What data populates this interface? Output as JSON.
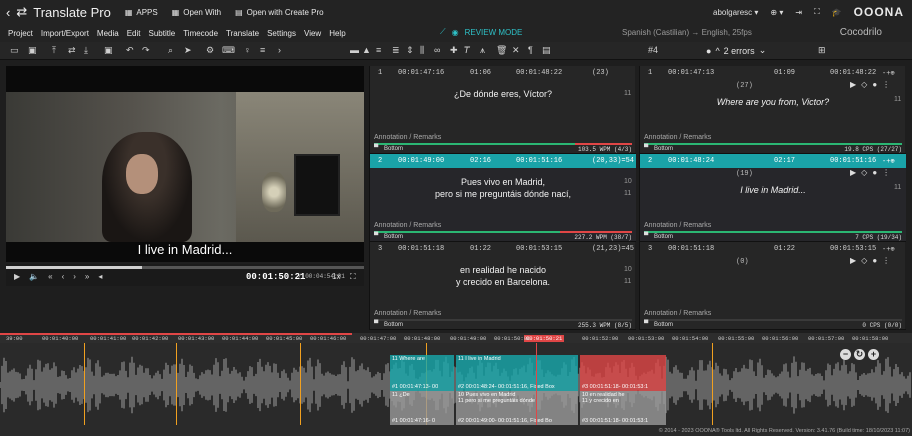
{
  "app": {
    "title": "Translate Pro",
    "apps_label": "APPS",
    "open_with_label": "Open With",
    "open_create_label": "Open with Create Pro",
    "user": "abolgaresc",
    "logo_text": "OOONA"
  },
  "menu": {
    "items": [
      "Project",
      "Import/Export",
      "Media",
      "Edit",
      "Subtitle",
      "Timecode",
      "Translate",
      "Settings",
      "View",
      "Help"
    ],
    "review_mode": "REVIEW MODE",
    "language_pair": "Spanish (Castilian) → English, 25fps",
    "project_name": "Cocodrilo"
  },
  "toolbar": {
    "current_number": "#4",
    "errors_label": "2 errors"
  },
  "video": {
    "subtitle": "I live in Madrid...",
    "current_time": "00:01:50:21",
    "duration": "/ 00:04:54:01",
    "speed": "1x"
  },
  "source": {
    "rows": [
      {
        "num": "1",
        "in": "00:01:47:16",
        "dur": "01:06",
        "out": "00:01:48:22",
        "chars": "(23)",
        "text1": "¿De dónde eres, Víctor?",
        "text2": "",
        "cc1": "11",
        "cc2": "",
        "annotation": "Annotation / Remarks",
        "position": "Bottom",
        "wpm": "103.5 WPM (4/3)",
        "bar": 0.78,
        "active": false
      },
      {
        "num": "2",
        "in": "00:01:49:00",
        "dur": "02:16",
        "out": "00:01:51:16",
        "chars": "(20,33)=54",
        "text1": "Pues vivo en Madrid,",
        "text2": "pero si me preguntáis dónde nací,",
        "cc1": "10",
        "cc2": "11",
        "annotation": "Annotation / Remarks",
        "position": "Bottom",
        "wpm": "227.2 WPM (38/7)",
        "bar": 0.72,
        "active": true
      },
      {
        "num": "3",
        "in": "00:01:51:18",
        "dur": "01:22",
        "out": "00:01:53:15",
        "chars": "(21,23)=45",
        "text1": "en realidad he nacido",
        "text2": "y crecido en Barcelona.",
        "cc1": "10",
        "cc2": "11",
        "annotation": "Annotation / Remarks",
        "position": "Bottom",
        "wpm": "255.3 WPM (8/5)",
        "bar": 0.0,
        "active": false
      }
    ]
  },
  "target": {
    "rows": [
      {
        "num": "1",
        "in": "00:01:47:13",
        "dur": "01:09",
        "out": "00:01:48:22",
        "chars": "(27)",
        "text1": "Where are you from, Victor?",
        "cc1": "11",
        "annotation": "Annotation / Remarks",
        "position": "Bottom",
        "cps": "19.8 CPS (27/27)",
        "bar": 1.0,
        "active": false
      },
      {
        "num": "2",
        "in": "00:01:48:24",
        "dur": "02:17",
        "out": "00:01:51:16",
        "chars": "(19)",
        "text1": "I live in Madrid...",
        "cc1": "11",
        "annotation": "Annotation / Remarks",
        "position": "Bottom",
        "cps": "7 CPS (19/34)",
        "bar": 1.0,
        "active": true
      },
      {
        "num": "3",
        "in": "00:01:51:18",
        "dur": "01:22",
        "out": "00:01:53:15",
        "chars": "(0)",
        "text1": "",
        "cc1": "",
        "annotation": "Annotation / Remarks",
        "position": "Bottom",
        "cps": "0 CPS (0/0)",
        "bar": 0.0,
        "active": false
      }
    ]
  },
  "timeline": {
    "ticks": [
      "39:00",
      "00:01:40:00",
      "00:01:41:00",
      "00:01:42:00",
      "00:01:43:00",
      "00:01:44:00",
      "00:01:45:00",
      "00:01:46:00",
      "00:01:47:00",
      "00:01:48:00",
      "00:01:49:00",
      "00:01:50:00",
      "00:01:52:00",
      "00:01:53:00",
      "00:01:54:00",
      "00:01:55:00",
      "00:01:56:00",
      "00:01:57:00",
      "00:01:58:00"
    ],
    "now_label": "00:01:50:21",
    "cues_top": [
      {
        "label": "11 Where are",
        "sub": "#1 00:01:47:13- 00",
        "color": "#18a9ad"
      },
      {
        "label": "11 I live in Madrid",
        "sub": "#2 00:01:48:24- 00:01:51:16, Fixed Box",
        "color": "#18a9ad"
      },
      {
        "label": "",
        "sub": "#3 00:01:51:18- 00:01:53:1",
        "color": "#e04646"
      }
    ],
    "cues_bottom": [
      {
        "label": "11 ¿De",
        "sub": "#1 00:01:47:16- 0"
      },
      {
        "label": "10 Pues vivo en Madrid",
        "label2": "11 pero si me preguntáis dónde",
        "sub": "#2 00:01:49:00- 00:01:51:16, Fixed Bo"
      },
      {
        "label": "10 en realidad he",
        "label2": "11 y crecido en",
        "sub": "#3 00:01:51:18- 00:01:53:1"
      }
    ],
    "copyright": "© 2014 - 2023 OOONA® Tools ltd. All Rights Reserved. Version: 3.41.76 (Build time: 18/10/2023 11:07)"
  }
}
